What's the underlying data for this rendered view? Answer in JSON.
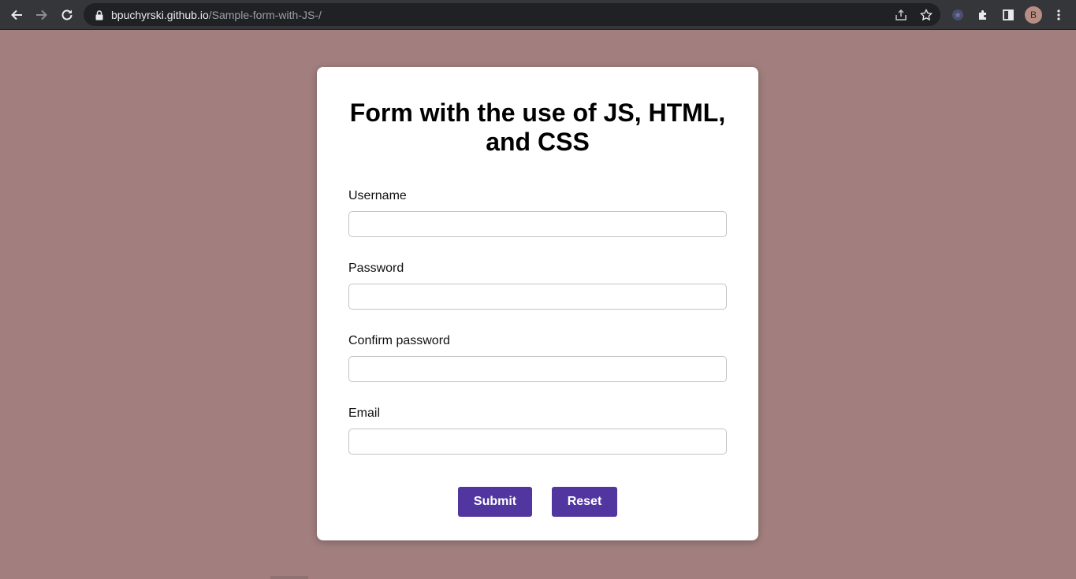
{
  "browser": {
    "url_host": "bpuchyrski.github.io",
    "url_path": "/Sample-form-with-JS-/",
    "profile_initial": "B",
    "icons": [
      "back-icon",
      "forward-icon",
      "reload-icon",
      "lock-icon",
      "share-icon",
      "star-icon",
      "extension-icon",
      "puzzle-icon",
      "side-panel-icon",
      "menu-icon"
    ]
  },
  "form": {
    "title": "Form with the use of JS, HTML, and CSS",
    "fields": [
      {
        "label": "Username",
        "value": ""
      },
      {
        "label": "Password",
        "value": ""
      },
      {
        "label": "Confirm password",
        "value": ""
      },
      {
        "label": "Email",
        "value": ""
      }
    ],
    "submit_label": "Submit",
    "reset_label": "Reset"
  },
  "colors": {
    "page_background": "#a27f7e",
    "button": "#5236a0",
    "card": "#ffffff"
  }
}
